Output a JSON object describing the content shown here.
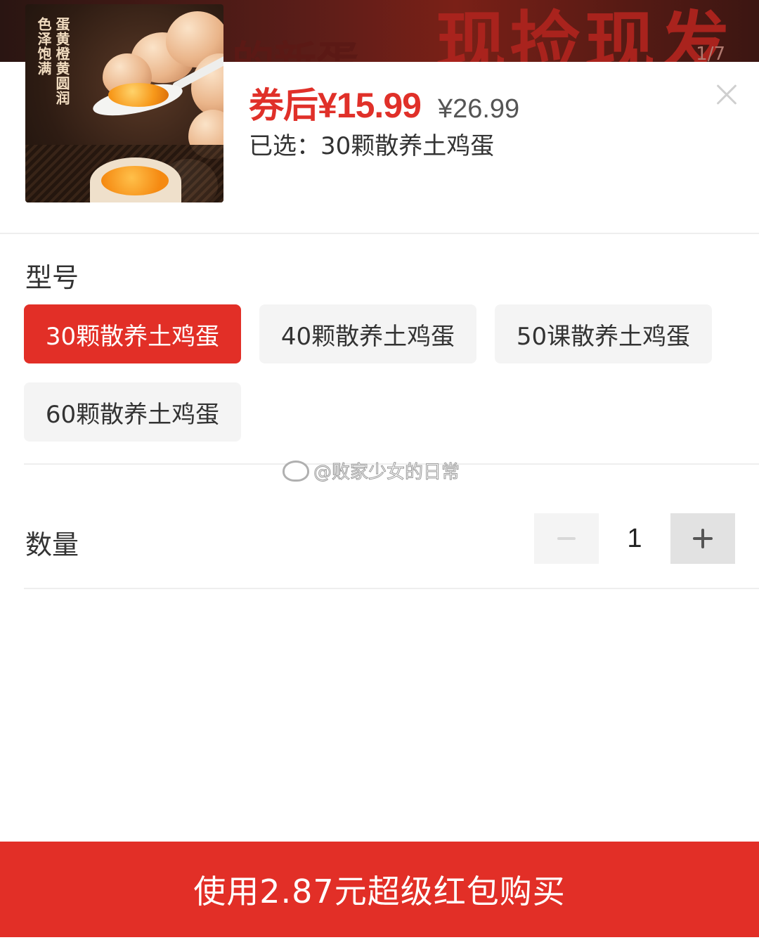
{
  "background": {
    "banner_text": "现捡现发",
    "banner_text_partial": "的新蛋",
    "image_counter": "1/7"
  },
  "product": {
    "thumbnail_caption": [
      "蛋黄橙黄圆润",
      "色泽饱满"
    ],
    "price_current": "券后¥15.99",
    "price_original": "¥26.99",
    "selected_text": "已选：30颗散养土鸡蛋"
  },
  "spec": {
    "title": "型号",
    "options": [
      {
        "label": "30颗散养土鸡蛋",
        "selected": true
      },
      {
        "label": "40颗散养土鸡蛋",
        "selected": false
      },
      {
        "label": "50课散养土鸡蛋",
        "selected": false
      },
      {
        "label": "60颗散养土鸡蛋",
        "selected": false
      }
    ]
  },
  "quantity": {
    "title": "数量",
    "value": "1"
  },
  "watermark": "@败家少女的日常",
  "buy_button": "使用2.87元超级红包购买",
  "colors": {
    "accent": "#e22f27",
    "price": "#e03029",
    "option_bg": "#f4f4f4"
  }
}
